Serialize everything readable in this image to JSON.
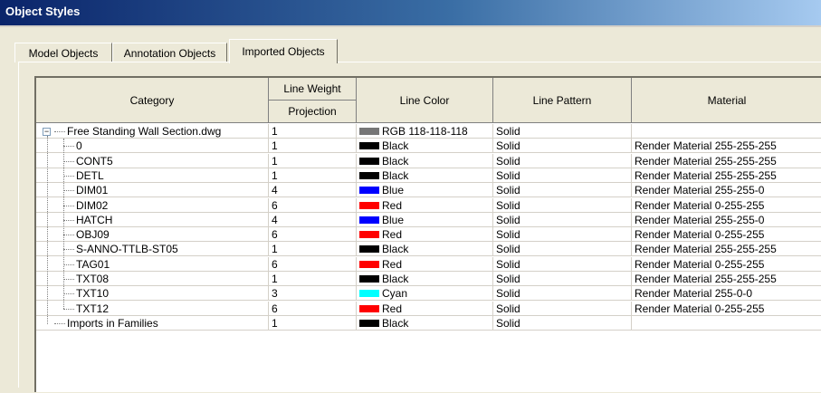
{
  "window": {
    "title": "Object Styles"
  },
  "tabs": [
    {
      "label": "Model Objects",
      "active": false
    },
    {
      "label": "Annotation Objects",
      "active": false
    },
    {
      "label": "Imported Objects",
      "active": true
    }
  ],
  "table": {
    "headers": {
      "category": "Category",
      "line_weight": "Line Weight",
      "projection": "Projection",
      "line_color": "Line Color",
      "line_pattern": "Line Pattern",
      "material": "Material"
    },
    "rows": [
      {
        "category": "Free Standing Wall Section.dwg",
        "weight": "1",
        "color_label": "RGB 118-118-118",
        "color": "#767676",
        "pattern": "Solid",
        "material": "",
        "level": 0,
        "expander": "−"
      },
      {
        "category": "0",
        "weight": "1",
        "color_label": "Black",
        "color": "#000000",
        "pattern": "Solid",
        "material": "Render Material 255-255-255",
        "level": 1
      },
      {
        "category": "CONT5",
        "weight": "1",
        "color_label": "Black",
        "color": "#000000",
        "pattern": "Solid",
        "material": "Render Material 255-255-255",
        "level": 1
      },
      {
        "category": "DETL",
        "weight": "1",
        "color_label": "Black",
        "color": "#000000",
        "pattern": "Solid",
        "material": "Render Material 255-255-255",
        "level": 1
      },
      {
        "category": "DIM01",
        "weight": "4",
        "color_label": "Blue",
        "color": "#0000ff",
        "pattern": "Solid",
        "material": "Render Material 255-255-0",
        "level": 1
      },
      {
        "category": "DIM02",
        "weight": "6",
        "color_label": "Red",
        "color": "#ff0000",
        "pattern": "Solid",
        "material": "Render Material 0-255-255",
        "level": 1
      },
      {
        "category": "HATCH",
        "weight": "4",
        "color_label": "Blue",
        "color": "#0000ff",
        "pattern": "Solid",
        "material": "Render Material 255-255-0",
        "level": 1
      },
      {
        "category": "OBJ09",
        "weight": "6",
        "color_label": "Red",
        "color": "#ff0000",
        "pattern": "Solid",
        "material": "Render Material 0-255-255",
        "level": 1
      },
      {
        "category": "S-ANNO-TTLB-ST05",
        "weight": "1",
        "color_label": "Black",
        "color": "#000000",
        "pattern": "Solid",
        "material": "Render Material 255-255-255",
        "level": 1
      },
      {
        "category": "TAG01",
        "weight": "6",
        "color_label": "Red",
        "color": "#ff0000",
        "pattern": "Solid",
        "material": "Render Material 0-255-255",
        "level": 1
      },
      {
        "category": "TXT08",
        "weight": "1",
        "color_label": "Black",
        "color": "#000000",
        "pattern": "Solid",
        "material": "Render Material 255-255-255",
        "level": 1
      },
      {
        "category": "TXT10",
        "weight": "3",
        "color_label": "Cyan",
        "color": "#00ffff",
        "pattern": "Solid",
        "material": "Render Material 255-0-0",
        "level": 1
      },
      {
        "category": "TXT12",
        "weight": "6",
        "color_label": "Red",
        "color": "#ff0000",
        "pattern": "Solid",
        "material": "Render Material 0-255-255",
        "level": 1
      },
      {
        "category": "Imports in Families",
        "weight": "1",
        "color_label": "Black",
        "color": "#000000",
        "pattern": "Solid",
        "material": "",
        "level": 0
      }
    ]
  }
}
